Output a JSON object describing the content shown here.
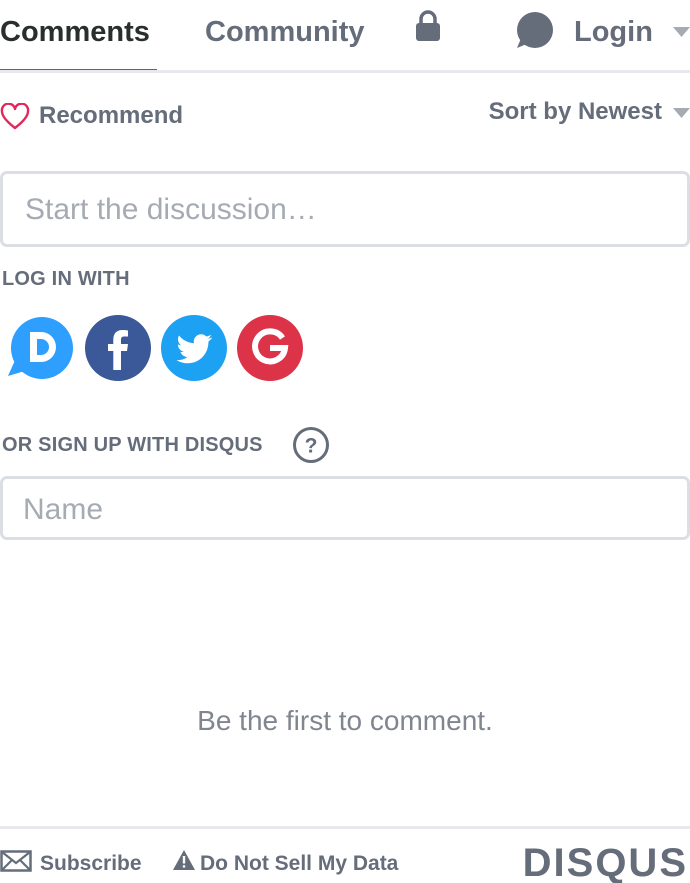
{
  "nav": {
    "tabs": [
      {
        "label": "Comments"
      },
      {
        "label": "Community"
      }
    ],
    "login_label": "Login"
  },
  "actions": {
    "recommend_label": "Recommend",
    "sort_label": "Sort by Newest"
  },
  "composer": {
    "placeholder": "Start the discussion…"
  },
  "login_with": {
    "label": "LOG IN WITH",
    "providers": [
      {
        "name": "Disqus",
        "letter": "D",
        "color": "#2e9fff"
      },
      {
        "name": "Facebook",
        "letter": "f",
        "color": "#3b5998"
      },
      {
        "name": "Twitter",
        "icon": "bird",
        "color": "#1da1f2"
      },
      {
        "name": "Google",
        "letter": "G",
        "color": "#dd3348"
      }
    ]
  },
  "signup": {
    "label": "OR SIGN UP WITH DISQUS",
    "help_symbol": "?",
    "name_placeholder": "Name"
  },
  "empty_message": "Be the first to comment.",
  "footer": {
    "subscribe_label": "Subscribe",
    "do_not_sell_label": "Do Not Sell My Data",
    "brand": "DISQUS"
  },
  "colors": {
    "accent": "#e2285a",
    "text_muted": "#656c7a",
    "text_dark": "#2a2e2e",
    "border": "#dbdfe4"
  }
}
